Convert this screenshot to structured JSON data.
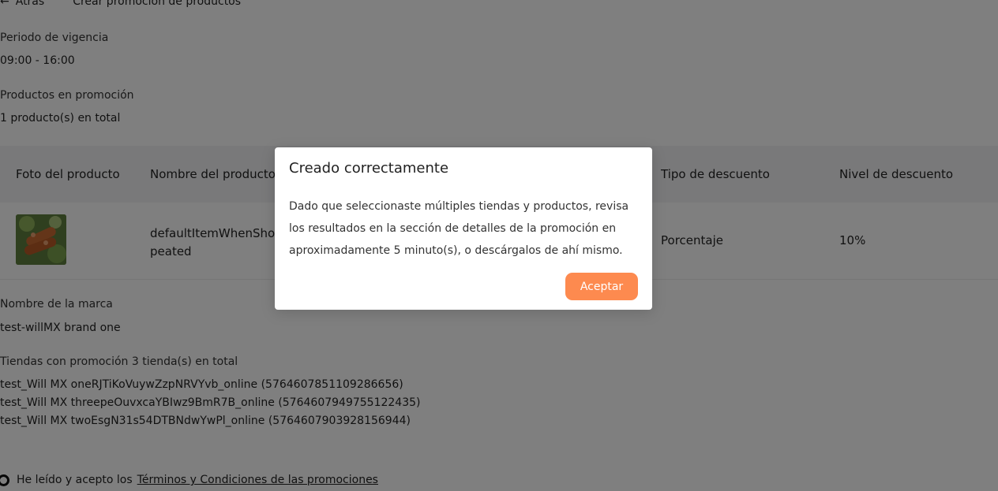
{
  "header": {
    "back_label": "Atrás",
    "title": "Crear promoción de productos"
  },
  "validity": {
    "label": "Periodo de vigencia",
    "value": "09:00 - 16:00"
  },
  "products": {
    "label": "Productos en promoción",
    "count_text": "1 producto(s) en total"
  },
  "table": {
    "columns": {
      "photo": "Foto del producto",
      "name": "Nombre del producto",
      "discount_type": "Tipo de descuento",
      "discount_level": "Nivel de descuento"
    },
    "rows": [
      {
        "name": "defaultItemWhenShopeated",
        "discount_type": "Porcentaje",
        "discount_level": "10%"
      }
    ]
  },
  "brand": {
    "label": "Nombre de la marca",
    "value": "test-willMX brand one"
  },
  "stores": {
    "label": "Tiendas con promoción 3 tienda(s) en total",
    "items": [
      "test_Will MX oneRJTiKoVuywZzpNRVYvb_online (5764607851109286656)",
      "test_Will MX threepeOuvxcaYBIwz9BmR7B_online (5764607949755122435)",
      "test_Will MX twoEsgN31s54DTBNdwYwPl_online (5764607903928156944)"
    ]
  },
  "terms": {
    "prefix": "He leído y acepto los",
    "link": "Términos y Condiciones de las promociones"
  },
  "modal": {
    "title": "Creado correctamente",
    "body_lines": [
      "Dado que seleccionaste múltiples tiendas y productos, revisa",
      "los resultados en la sección de detalles de la promoción en",
      "aproximadamente 5 minuto(s), o descárgalos de ahí mismo."
    ],
    "accept_label": "Aceptar"
  },
  "colors": {
    "accent": "#fd8a4f",
    "overlay": "rgba(0,0,0,0.5)",
    "table_header_bg": "#f2f3f5"
  },
  "icons": {
    "back": "arrow-left-icon",
    "terms_radio": "radio-checked-icon"
  }
}
